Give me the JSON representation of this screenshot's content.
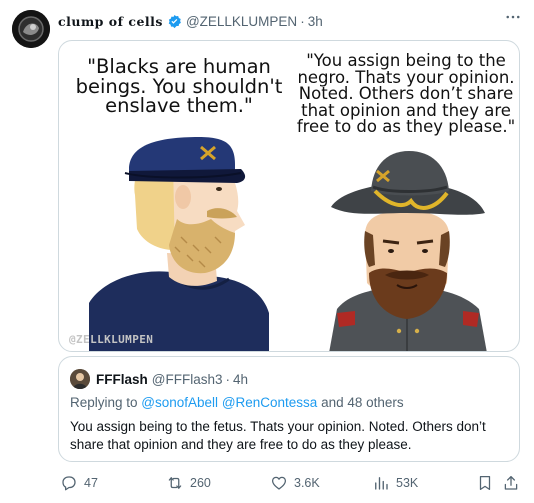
{
  "tweet": {
    "author": {
      "display_name": "clump of cells",
      "handle": "@ZELLKLUMPEN",
      "separator": "·",
      "time": "3h",
      "verified_icon": "verified-badge-icon"
    },
    "more_icon": "more-horizontal-icon",
    "media": {
      "left_caption": "\"Blacks are human beings. You shouldn't enslave them.\"",
      "right_caption": "\"You assign being to the negro. Thats your opinion. Noted. Others don’t share that opinion and they are free to do as they please.\"",
      "watermark": "@ZELLKLUMPEN"
    },
    "quote": {
      "name": "FFFlash",
      "handle": "@FFFlash3",
      "separator": "·",
      "time": "4h",
      "replying_prefix": "Replying to ",
      "mention_1": "@sonofAbell",
      "mention_2": "@RenContessa",
      "replying_suffix": " and 48 others",
      "text": "You assign being to the fetus. Thats your opinion. Noted. Others don’t share that opinion and they are free to do as they please."
    },
    "actions": {
      "replies": "47",
      "retweets": "260",
      "likes": "3.6K",
      "views": "53K"
    }
  },
  "colors": {
    "accent": "#1d9bf0",
    "secondary_text": "#536471",
    "border": "#cfd9de",
    "union_blue": "#1e2d5c",
    "confederate_gray": "#4e5256"
  }
}
